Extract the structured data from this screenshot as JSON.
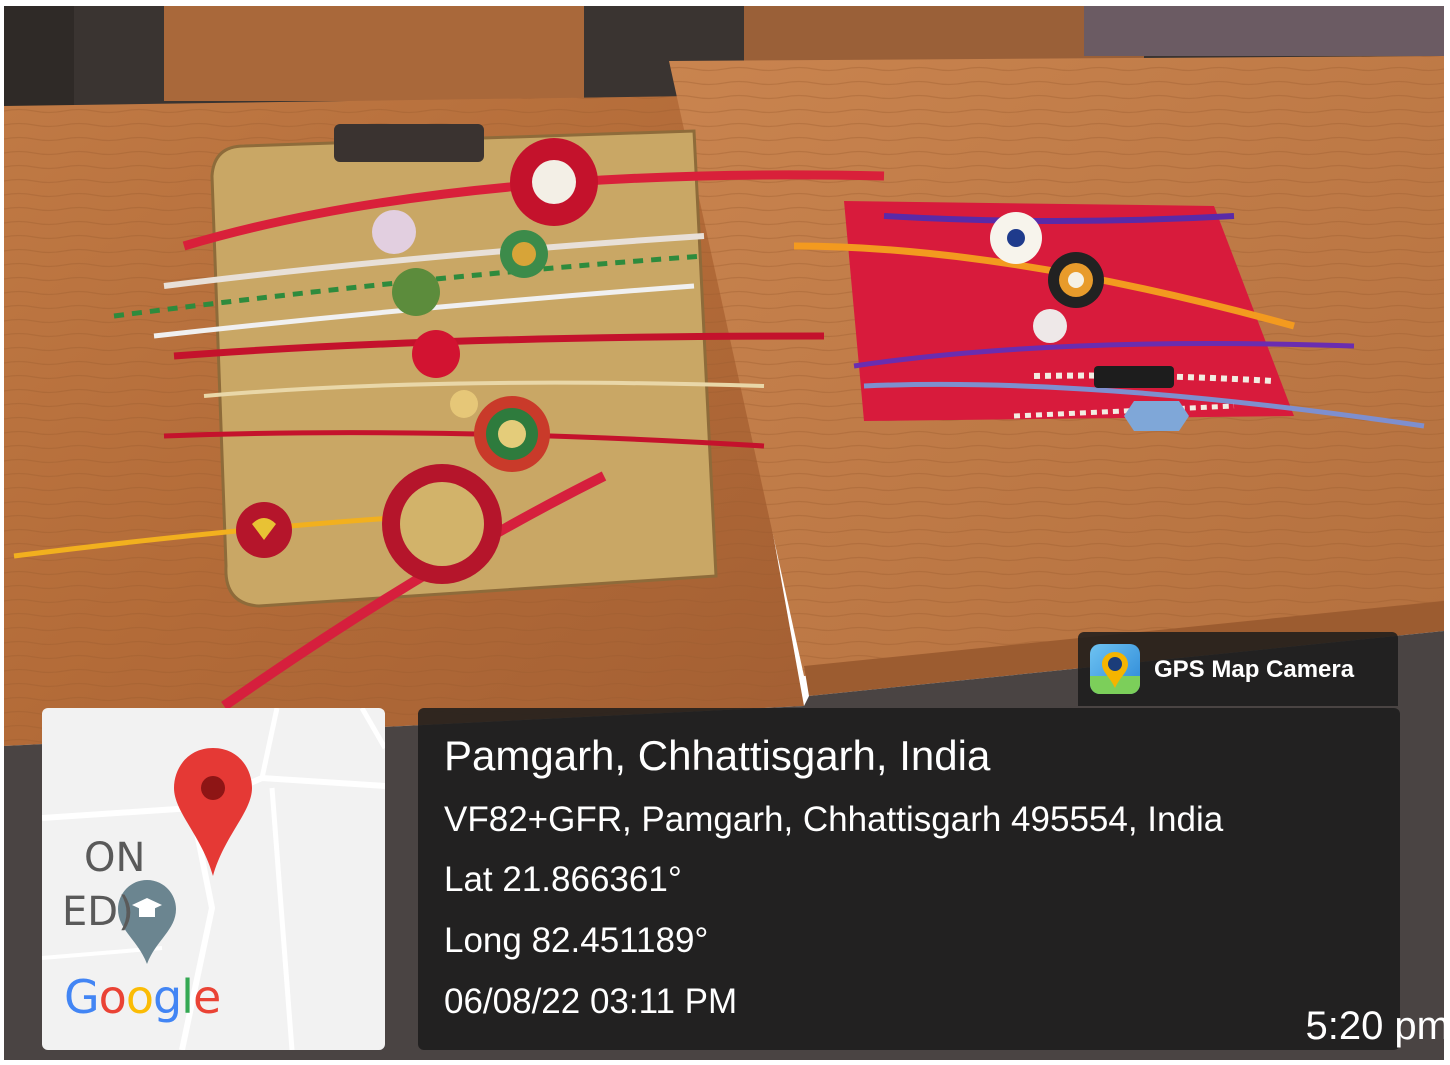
{
  "photo": {
    "subject": "handmade rakhis displayed on cardboard and red cloth on wooden desks"
  },
  "map": {
    "place_label_line1": "ON",
    "place_label_line2": "ED)",
    "google_letters": [
      "G",
      "o",
      "o",
      "g",
      "l",
      "e"
    ],
    "google_colors": [
      "#4285F4",
      "#EA4335",
      "#FBBC05",
      "#4285F4",
      "#34A853",
      "#EA4335"
    ],
    "pin_color": "#E53935",
    "pin_icon": "map-pin-icon",
    "school_icon": "graduation-cap-icon"
  },
  "brand": {
    "name": "GPS Map Camera",
    "icon": "gps-map-camera-icon"
  },
  "location": {
    "title": "Pamgarh, Chhattisgarh, India",
    "address": "VF82+GFR, Pamgarh, Chhattisgarh 495554, India",
    "lat": "Lat 21.866361°",
    "long": "Long 82.451189°",
    "datetime": "06/08/22 03:11 PM"
  },
  "status": {
    "time": "5:20 pm"
  }
}
